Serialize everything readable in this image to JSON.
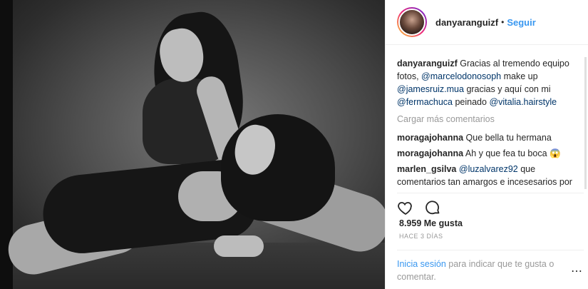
{
  "post": {
    "username": "danyaranguizf",
    "dot": "•",
    "follow_label": "Seguir",
    "caption": {
      "user": "danyaranguizf",
      "t1": " Gracias al tremendo equipo fotos, ",
      "m1": "@marcelodonosoph",
      "t2": " make up ",
      "m2": "@jamesruiz.mua",
      "t3": " gracias y aquí con mi ",
      "m3": "@fermachuca",
      "t4": " peinado ",
      "m4": "@vitalia.hairstyle"
    },
    "load_more": "Cargar más comentarios",
    "comments": [
      {
        "user": "moragajohanna",
        "text": " Que bella tu hermana"
      },
      {
        "user": "moragajohanna",
        "text": " Ah y que fea tu boca 😱"
      },
      {
        "user": "marlen_gsilva",
        "mention": "@luzalvarez92",
        "text": " que comentarios tan amargos e incesesarios por dios."
      }
    ],
    "likes": "8.959 Me gusta",
    "time": "HACE 3 DÍAS",
    "login_link": "Inicia sesión",
    "login_text": " para indicar que te gusta o comentar.",
    "more_label": "⋯"
  },
  "colors": {
    "link": "#3897f0",
    "mention": "#003569",
    "muted": "#999999"
  },
  "icons": [
    "heart-icon",
    "comment-icon",
    "more-options-icon"
  ]
}
